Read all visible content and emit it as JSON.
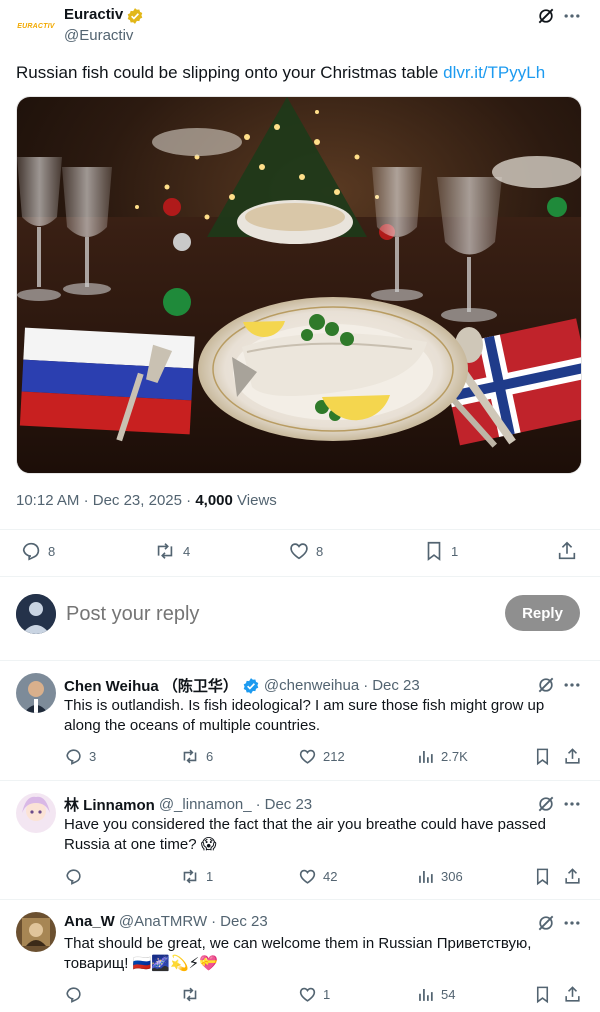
{
  "tweet": {
    "logo_text": "EURACTIV",
    "author_name": "Euractiv",
    "author_handle": "@Euractiv",
    "text": "Russian fish could be slipping onto your Christmas table ",
    "link_text": "dlvr.it/TPyyLh",
    "time": "10:12 AM",
    "date": "Dec 23, 2025",
    "views_count": "4,000",
    "views_label": "Views",
    "stats": {
      "replies": "8",
      "reposts": "4",
      "likes": "8",
      "bookmarks": "1"
    }
  },
  "composer": {
    "placeholder": "Post your reply",
    "button_label": "Reply"
  },
  "replies": [
    {
      "name": "Chen Weihua （陈卫华）",
      "handle": "@chenweihua",
      "date": "Dec 23",
      "text": "This is outlandish. Is fish ideological? I am sure those fish might grow up along the oceans of multiple countries.",
      "replies": "3",
      "reposts": "6",
      "likes": "212",
      "views": "2.7K"
    },
    {
      "name": "林 Linnamon",
      "handle": "@_linnamon_",
      "date": "Dec 23",
      "text": "Have you considered the fact that the air you breathe could have passed Russia at one time? 😱",
      "replies": "",
      "reposts": "1",
      "likes": "42",
      "views": "306"
    },
    {
      "name": "Ana_W",
      "handle": "@AnaTMRW",
      "date": "Dec 23",
      "text": "That should be great, we can welcome them in Russian Приветствую, товарищ! 🇷🇺🌌💫⚡💝",
      "replies": "",
      "reposts": "",
      "likes": "1",
      "views": "54"
    }
  ],
  "separator": "·",
  "colors": {
    "accent": "#1d9bf0",
    "muted": "#536471",
    "verified": "#1d9bf0",
    "logo": "#f2a900",
    "button_disabled": "#8f8f8f"
  }
}
